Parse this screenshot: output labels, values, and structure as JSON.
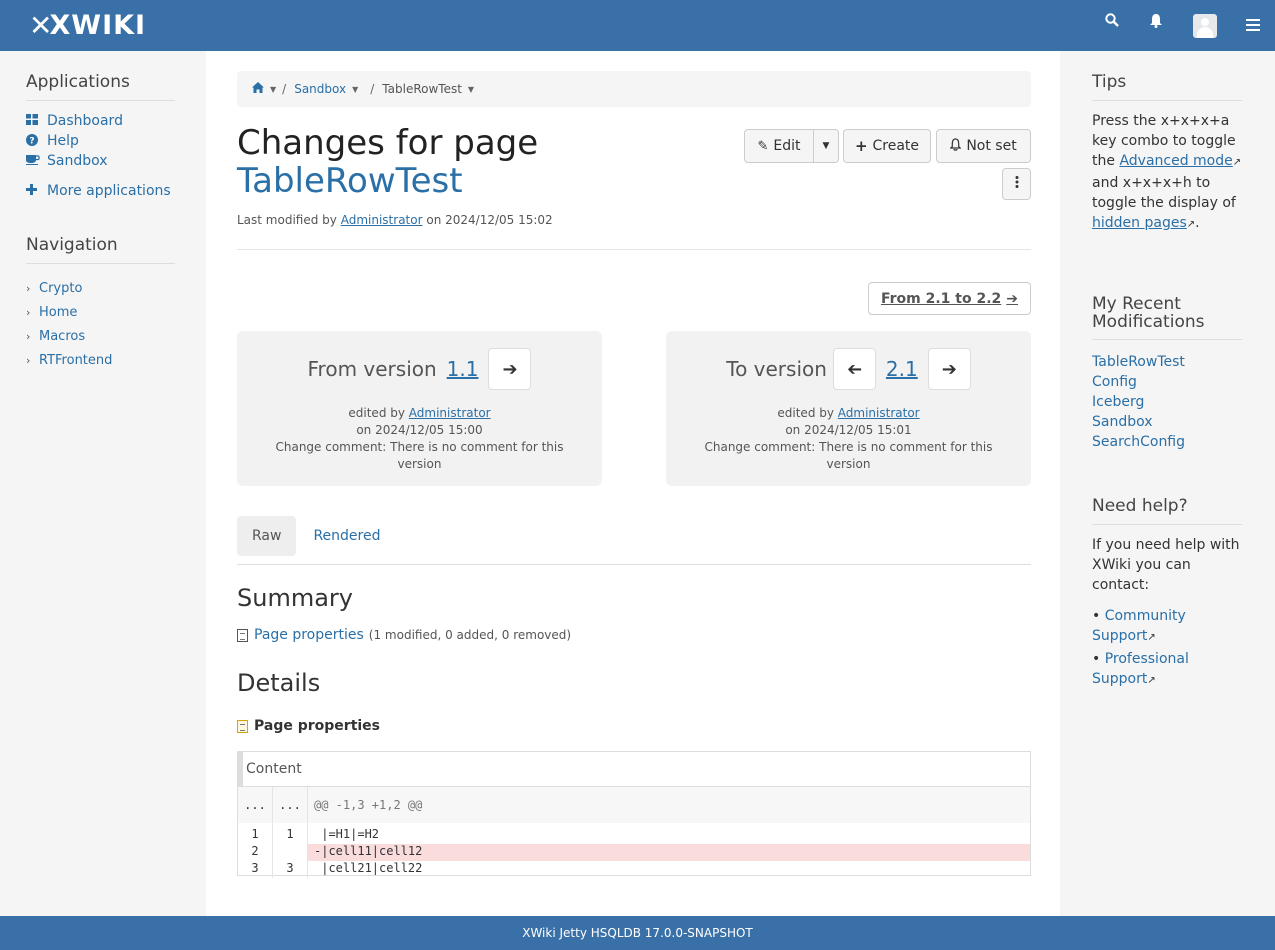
{
  "topbar": {
    "logo_text": "XWIKI",
    "icons": [
      "search-icon",
      "bell-icon",
      "avatar",
      "menu-icon"
    ]
  },
  "left": {
    "applications_title": "Applications",
    "apps": [
      {
        "label": "Dashboard",
        "icon": "dashboard-icon"
      },
      {
        "label": "Help",
        "icon": "help-icon"
      },
      {
        "label": "Sandbox",
        "icon": "coffee-icon"
      }
    ],
    "more_apps": "More applications",
    "navigation_title": "Navigation",
    "nav": [
      "Crypto",
      "Home",
      "Macros",
      "RTFrontend"
    ]
  },
  "breadcrumb": {
    "space": "Sandbox",
    "page": "TableRowTest"
  },
  "header": {
    "title_prefix": "Changes for page",
    "page_name": "TableRowTest",
    "last_modified_prefix": "Last modified by",
    "last_modified_user": "Administrator",
    "last_modified_date": "on 2024/12/05 15:02"
  },
  "actions": {
    "edit": "Edit",
    "create": "Create",
    "notify": "Not set"
  },
  "compare": {
    "from_to_label": "From 2.1 to 2.2",
    "from": {
      "label": "From version",
      "version": "1.1",
      "edited_by_prefix": "edited by",
      "user": "Administrator",
      "date": "on 2024/12/05 15:00",
      "comment": "Change comment: There is no comment for this version"
    },
    "to": {
      "label": "To version",
      "version": "2.1",
      "edited_by_prefix": "edited by",
      "user": "Administrator",
      "date": "on 2024/12/05 15:01",
      "comment": "Change comment: There is no comment for this version"
    }
  },
  "tabs": [
    "Raw",
    "Rendered"
  ],
  "summary": {
    "title": "Summary",
    "item": "Page properties",
    "stats": "(1 modified, 0 added, 0 removed)"
  },
  "details": {
    "title": "Details",
    "section": "Page properties",
    "field": "Content",
    "hunk": "@@ -1,3 +1,2 @@",
    "hunk_n": "...",
    "lines": [
      {
        "old": "1",
        "new": "1",
        "text": " |=H1|=H2",
        "type": "context"
      },
      {
        "old": "2",
        "new": "",
        "text": "-|cell11|cell12",
        "type": "removed"
      },
      {
        "old": "3",
        "new": "3",
        "text": " |cell21|cell22",
        "type": "context"
      }
    ]
  },
  "right": {
    "tips_title": "Tips",
    "tips_text_1": "Press the x+x+x+a key combo to toggle the",
    "tips_link_1": "Advanced mode",
    "tips_text_2": "and x+x+x+h to toggle the display of",
    "tips_link_2": "hidden pages",
    "recent_title": "My Recent Modifications",
    "recent": [
      "TableRowTest",
      "Config",
      "Iceberg",
      "Sandbox",
      "SearchConfig"
    ],
    "help_title": "Need help?",
    "help_text": "If you need help with XWiki you can contact:",
    "help_links": [
      "Community Support",
      "Professional Support"
    ]
  },
  "footer": {
    "text": "XWiki Jetty HSQLDB 17.0.0-SNAPSHOT"
  }
}
